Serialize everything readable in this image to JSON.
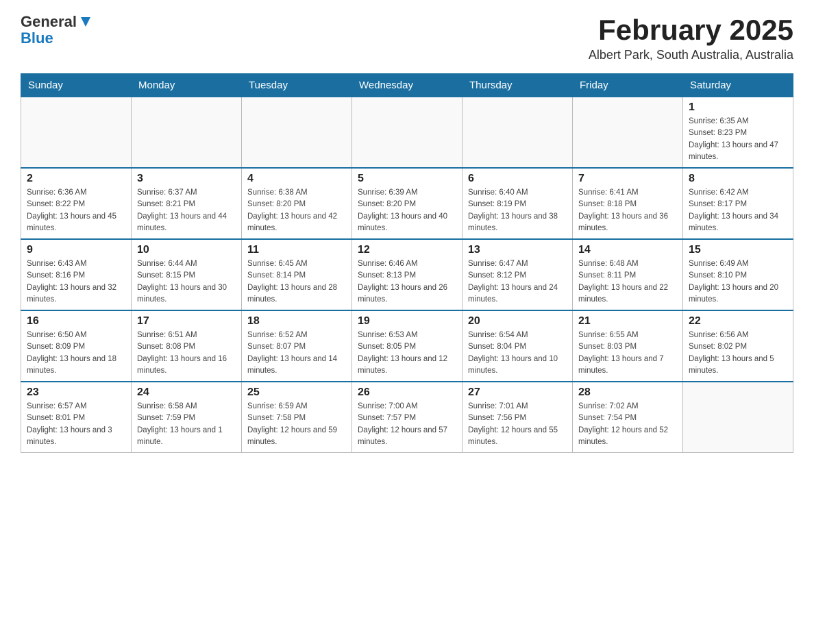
{
  "header": {
    "logo": {
      "general": "General",
      "blue": "Blue"
    },
    "month": "February 2025",
    "location": "Albert Park, South Australia, Australia"
  },
  "weekdays": [
    "Sunday",
    "Monday",
    "Tuesday",
    "Wednesday",
    "Thursday",
    "Friday",
    "Saturday"
  ],
  "weeks": [
    [
      {
        "day": "",
        "info": ""
      },
      {
        "day": "",
        "info": ""
      },
      {
        "day": "",
        "info": ""
      },
      {
        "day": "",
        "info": ""
      },
      {
        "day": "",
        "info": ""
      },
      {
        "day": "",
        "info": ""
      },
      {
        "day": "1",
        "info": "Sunrise: 6:35 AM\nSunset: 8:23 PM\nDaylight: 13 hours and 47 minutes."
      }
    ],
    [
      {
        "day": "2",
        "info": "Sunrise: 6:36 AM\nSunset: 8:22 PM\nDaylight: 13 hours and 45 minutes."
      },
      {
        "day": "3",
        "info": "Sunrise: 6:37 AM\nSunset: 8:21 PM\nDaylight: 13 hours and 44 minutes."
      },
      {
        "day": "4",
        "info": "Sunrise: 6:38 AM\nSunset: 8:20 PM\nDaylight: 13 hours and 42 minutes."
      },
      {
        "day": "5",
        "info": "Sunrise: 6:39 AM\nSunset: 8:20 PM\nDaylight: 13 hours and 40 minutes."
      },
      {
        "day": "6",
        "info": "Sunrise: 6:40 AM\nSunset: 8:19 PM\nDaylight: 13 hours and 38 minutes."
      },
      {
        "day": "7",
        "info": "Sunrise: 6:41 AM\nSunset: 8:18 PM\nDaylight: 13 hours and 36 minutes."
      },
      {
        "day": "8",
        "info": "Sunrise: 6:42 AM\nSunset: 8:17 PM\nDaylight: 13 hours and 34 minutes."
      }
    ],
    [
      {
        "day": "9",
        "info": "Sunrise: 6:43 AM\nSunset: 8:16 PM\nDaylight: 13 hours and 32 minutes."
      },
      {
        "day": "10",
        "info": "Sunrise: 6:44 AM\nSunset: 8:15 PM\nDaylight: 13 hours and 30 minutes."
      },
      {
        "day": "11",
        "info": "Sunrise: 6:45 AM\nSunset: 8:14 PM\nDaylight: 13 hours and 28 minutes."
      },
      {
        "day": "12",
        "info": "Sunrise: 6:46 AM\nSunset: 8:13 PM\nDaylight: 13 hours and 26 minutes."
      },
      {
        "day": "13",
        "info": "Sunrise: 6:47 AM\nSunset: 8:12 PM\nDaylight: 13 hours and 24 minutes."
      },
      {
        "day": "14",
        "info": "Sunrise: 6:48 AM\nSunset: 8:11 PM\nDaylight: 13 hours and 22 minutes."
      },
      {
        "day": "15",
        "info": "Sunrise: 6:49 AM\nSunset: 8:10 PM\nDaylight: 13 hours and 20 minutes."
      }
    ],
    [
      {
        "day": "16",
        "info": "Sunrise: 6:50 AM\nSunset: 8:09 PM\nDaylight: 13 hours and 18 minutes."
      },
      {
        "day": "17",
        "info": "Sunrise: 6:51 AM\nSunset: 8:08 PM\nDaylight: 13 hours and 16 minutes."
      },
      {
        "day": "18",
        "info": "Sunrise: 6:52 AM\nSunset: 8:07 PM\nDaylight: 13 hours and 14 minutes."
      },
      {
        "day": "19",
        "info": "Sunrise: 6:53 AM\nSunset: 8:05 PM\nDaylight: 13 hours and 12 minutes."
      },
      {
        "day": "20",
        "info": "Sunrise: 6:54 AM\nSunset: 8:04 PM\nDaylight: 13 hours and 10 minutes."
      },
      {
        "day": "21",
        "info": "Sunrise: 6:55 AM\nSunset: 8:03 PM\nDaylight: 13 hours and 7 minutes."
      },
      {
        "day": "22",
        "info": "Sunrise: 6:56 AM\nSunset: 8:02 PM\nDaylight: 13 hours and 5 minutes."
      }
    ],
    [
      {
        "day": "23",
        "info": "Sunrise: 6:57 AM\nSunset: 8:01 PM\nDaylight: 13 hours and 3 minutes."
      },
      {
        "day": "24",
        "info": "Sunrise: 6:58 AM\nSunset: 7:59 PM\nDaylight: 13 hours and 1 minute."
      },
      {
        "day": "25",
        "info": "Sunrise: 6:59 AM\nSunset: 7:58 PM\nDaylight: 12 hours and 59 minutes."
      },
      {
        "day": "26",
        "info": "Sunrise: 7:00 AM\nSunset: 7:57 PM\nDaylight: 12 hours and 57 minutes."
      },
      {
        "day": "27",
        "info": "Sunrise: 7:01 AM\nSunset: 7:56 PM\nDaylight: 12 hours and 55 minutes."
      },
      {
        "day": "28",
        "info": "Sunrise: 7:02 AM\nSunset: 7:54 PM\nDaylight: 12 hours and 52 minutes."
      },
      {
        "day": "",
        "info": ""
      }
    ]
  ]
}
